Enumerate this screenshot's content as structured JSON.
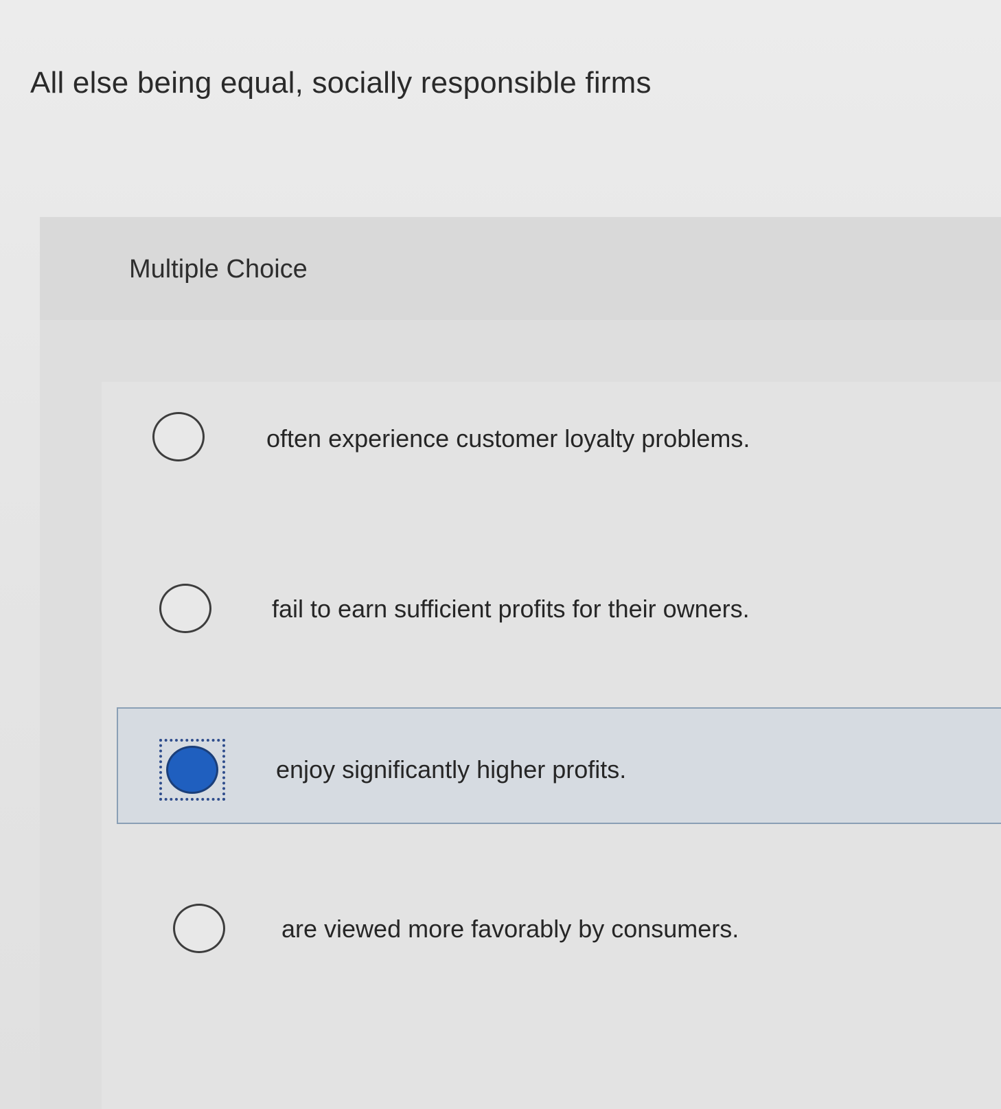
{
  "question": {
    "text": "All else being equal, socially responsible firms"
  },
  "panel": {
    "label": "Multiple Choice"
  },
  "options": [
    {
      "text": "often experience customer loyalty problems.",
      "selected": false
    },
    {
      "text": "fail to earn sufficient profits for their owners.",
      "selected": false
    },
    {
      "text": "enjoy significantly higher profits.",
      "selected": true
    },
    {
      "text": "are viewed more favorably by consumers.",
      "selected": false
    }
  ],
  "colors": {
    "selected_radio_fill": "#1f5fbf",
    "selected_border": "#8a9fb5",
    "focus_outline": "#2f4d8c"
  },
  "icons": {
    "radio_unchecked": "radio-unchecked-icon",
    "radio_checked": "radio-checked-icon"
  }
}
